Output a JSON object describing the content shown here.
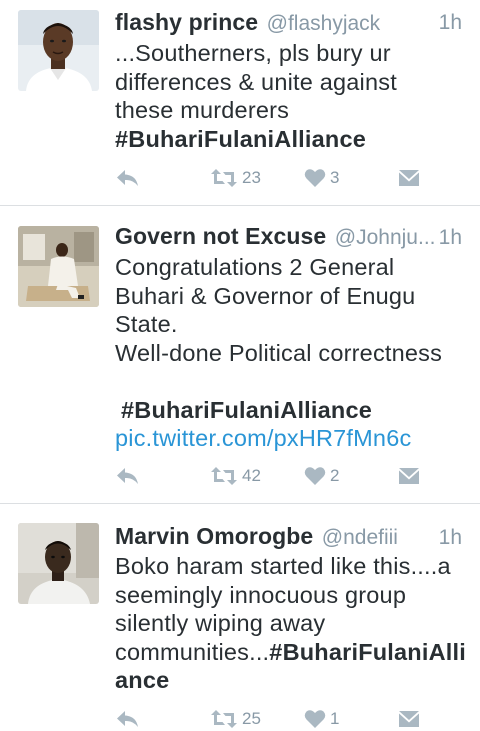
{
  "tweets": [
    {
      "name": "flashy prince",
      "handle": "@flashyjack",
      "time": "1h",
      "lines": [
        "...Southerners, pls bury ur",
        "differences & unite against",
        "these murderers"
      ],
      "hashtag": "#BuhariFulaniAlliance",
      "retweets": "23",
      "likes": "3"
    },
    {
      "name": "Govern not Excuse",
      "handle": "@Johnju...",
      "time": "1h",
      "lines": [
        "Congratulations 2 General",
        "Buhari &  Governor of Enugu",
        "State.",
        "Well-done Political correctness"
      ],
      "hashtag": "#BuhariFulaniAlliance",
      "link": "pic.twitter.com/pxHR7fMn6c",
      "retweets": "42",
      "likes": "2"
    },
    {
      "name": "Marvin Omorogbe",
      "handle": "@ndefiii",
      "time": "1h",
      "lines": [
        "Boko haram started like this....a",
        "seemingly innocuous group",
        "silently wiping away"
      ],
      "line_prefix": "communities...",
      "hashtag_part1": "#BuhariFulaniAlli",
      "hashtag_part2": "ance",
      "retweets": "25",
      "likes": "1"
    }
  ],
  "icons": {
    "reply": "reply-icon",
    "retweet": "retweet-icon",
    "like": "heart-icon",
    "message": "envelope-icon"
  },
  "colors": {
    "text": "#292f33",
    "secondary": "#8899a6",
    "link": "#2a95d6",
    "action_icon": "#aab8c2",
    "divider": "#dcdfe2"
  }
}
